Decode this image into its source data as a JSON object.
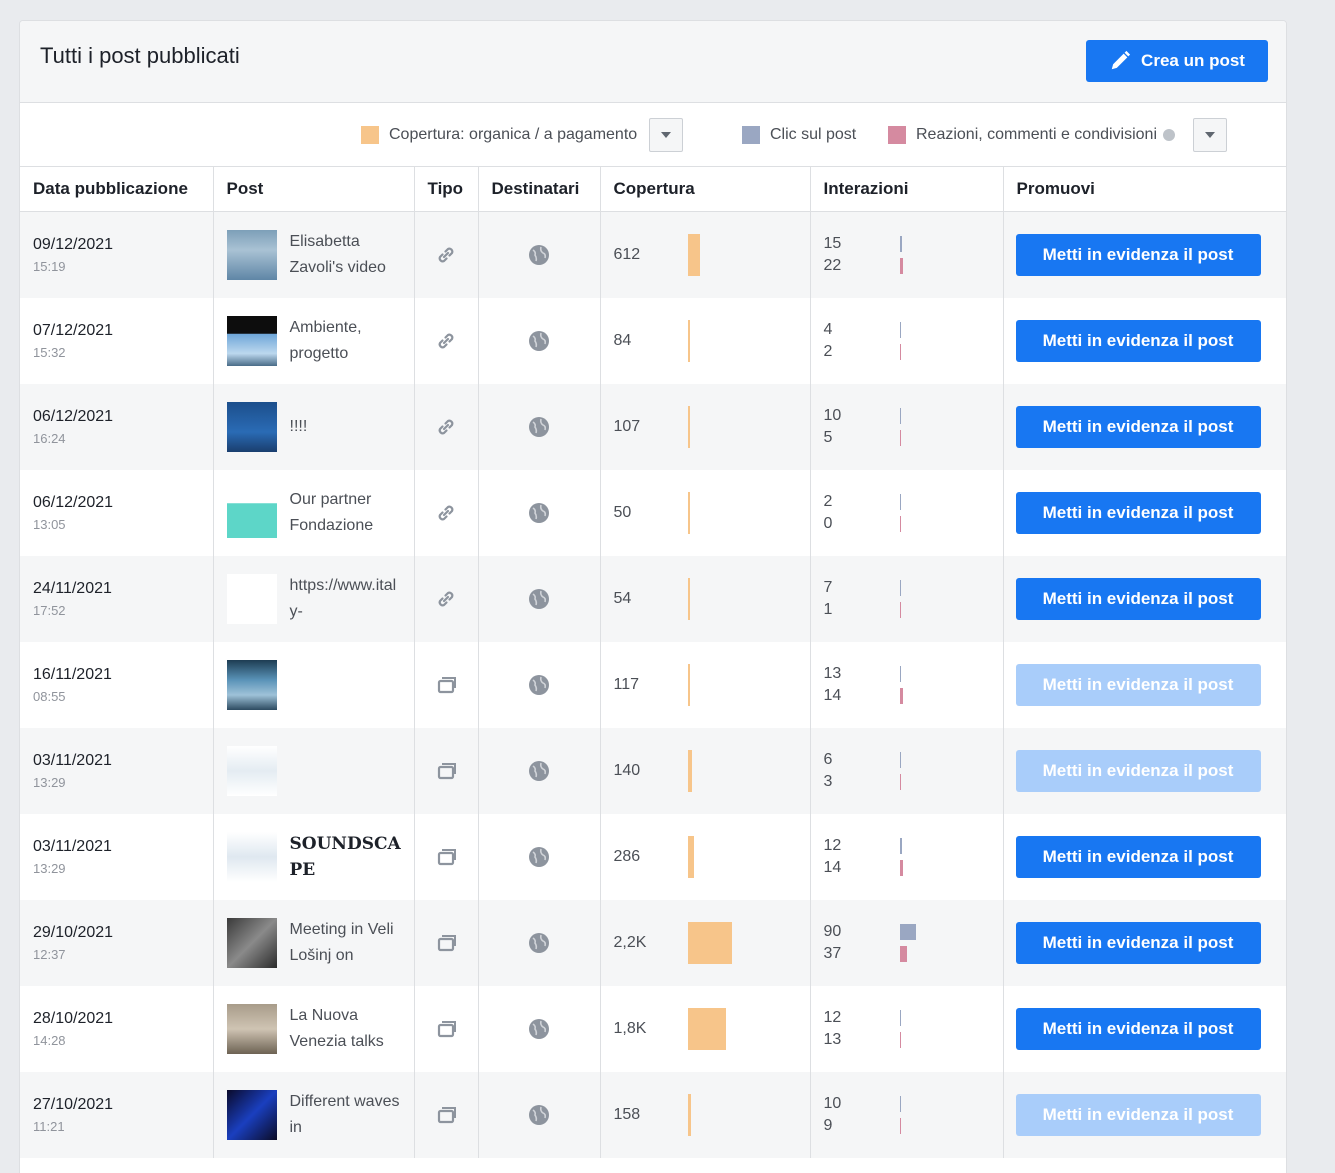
{
  "header": {
    "title": "Tutti i post pubblicati",
    "create_label": "Crea un post"
  },
  "legend": {
    "reach_label": "Copertura: organica / a pagamento",
    "clicks_label": "Clic sul post",
    "reactions_label": "Reazioni, commenti e condivisioni",
    "colors": {
      "reach": "#f7c58a",
      "clicks": "#9aa7c2",
      "reactions": "#d58aa0"
    }
  },
  "columns": [
    "Data pubblicazione",
    "Post",
    "Tipo",
    "Destinatari",
    "Copertura",
    "Interazioni",
    "Promuovi"
  ],
  "rows": [
    {
      "date": "09/12/2021",
      "time": "15:19",
      "text": "Elisabetta Zavoli's video",
      "type": "link-icon",
      "audience": "globe-icon",
      "reach": "612",
      "clicks": "15",
      "reactions": "22",
      "promote": "Metti in evidenza il post",
      "enabled": true
    },
    {
      "date": "07/12/2021",
      "time": "15:32",
      "text": "Ambiente, progetto",
      "type": "link-icon",
      "audience": "globe-icon",
      "reach": "84",
      "clicks": "4",
      "reactions": "2",
      "promote": "Metti in evidenza il post",
      "enabled": true
    },
    {
      "date": "06/12/2021",
      "time": "16:24",
      "text": "!!!!",
      "type": "link-icon",
      "audience": "globe-icon",
      "reach": "107",
      "clicks": "10",
      "reactions": "5",
      "promote": "Metti in evidenza il post",
      "enabled": true
    },
    {
      "date": "06/12/2021",
      "time": "13:05",
      "text": "Our partner Fondazione",
      "type": "link-icon",
      "audience": "globe-icon",
      "reach": "50",
      "clicks": "2",
      "reactions": "0",
      "promote": "Metti in evidenza il post",
      "enabled": true
    },
    {
      "date": "24/11/2021",
      "time": "17:52",
      "text": "https://www.italy-",
      "type": "link-icon",
      "audience": "globe-icon",
      "reach": "54",
      "clicks": "7",
      "reactions": "1",
      "promote": "Metti in evidenza il post",
      "enabled": true
    },
    {
      "date": "16/11/2021",
      "time": "08:55",
      "text": "",
      "type": "album-icon",
      "audience": "globe-icon",
      "reach": "117",
      "clicks": "13",
      "reactions": "14",
      "promote": "Metti in evidenza il post",
      "enabled": false
    },
    {
      "date": "03/11/2021",
      "time": "13:29",
      "text": "",
      "type": "album-icon",
      "audience": "globe-icon",
      "reach": "140",
      "clicks": "6",
      "reactions": "3",
      "promote": "Metti in evidenza il post",
      "enabled": false
    },
    {
      "date": "03/11/2021",
      "time": "13:29",
      "text": "SOUNDSCAPE",
      "type": "album-icon",
      "audience": "globe-icon",
      "reach": "286",
      "clicks": "12",
      "reactions": "14",
      "promote": "Metti in evidenza il post",
      "enabled": true
    },
    {
      "date": "29/10/2021",
      "time": "12:37",
      "text": "Meeting in Veli Lošinj on",
      "type": "album-icon",
      "audience": "globe-icon",
      "reach": "2,2K",
      "clicks": "90",
      "reactions": "37",
      "promote": "Metti in evidenza il post",
      "enabled": true
    },
    {
      "date": "28/10/2021",
      "time": "14:28",
      "text": "La Nuova Venezia talks",
      "type": "album-icon",
      "audience": "globe-icon",
      "reach": "1,8K",
      "clicks": "12",
      "reactions": "13",
      "promote": "Metti in evidenza il post",
      "enabled": true
    },
    {
      "date": "27/10/2021",
      "time": "11:21",
      "text": "Different waves in",
      "type": "album-icon",
      "audience": "globe-icon",
      "reach": "158",
      "clicks": "10",
      "reactions": "9",
      "promote": "Metti in evidenza il post",
      "enabled": false
    }
  ]
}
